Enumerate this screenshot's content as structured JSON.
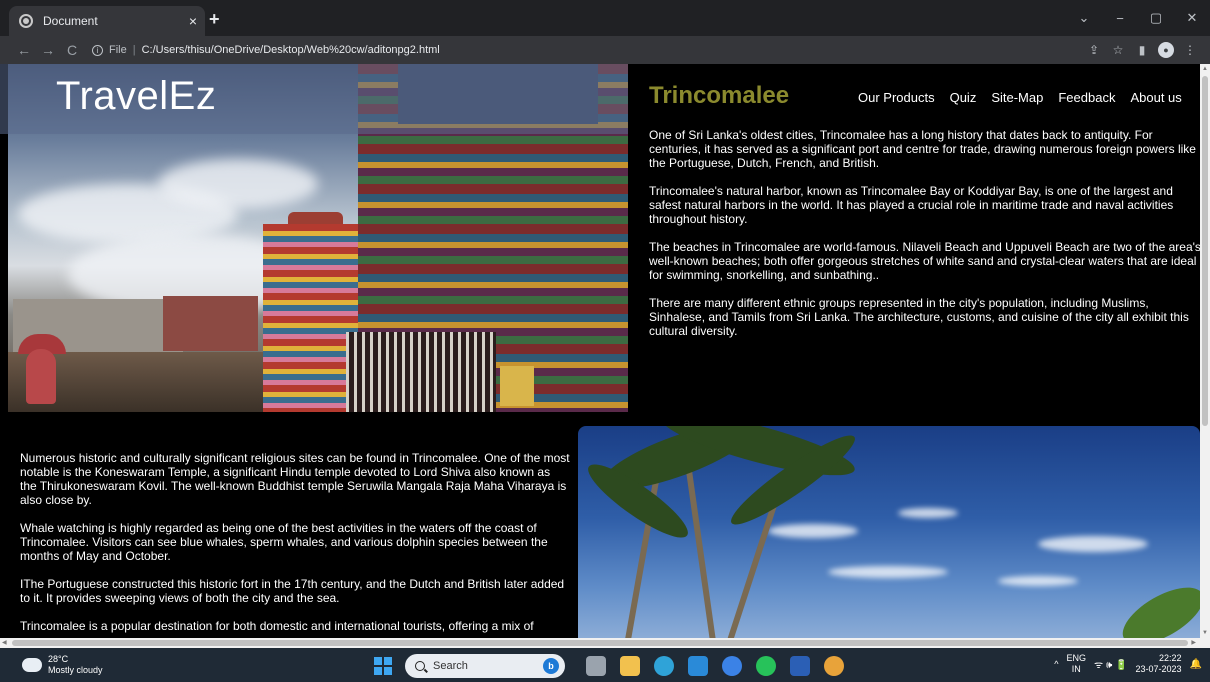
{
  "browser": {
    "tab_title": "Document",
    "tab_close": "×",
    "new_tab": "+",
    "window_controls": [
      "⌄",
      "−",
      "▢",
      "✕"
    ],
    "nav": {
      "back": "←",
      "forward": "→",
      "reload": "C"
    },
    "url_scheme": "File",
    "url_separator": "|",
    "url": "C:/Users/thisu/OneDrive/Desktop/Web%20cw/aditonpg2.html",
    "tool_icons": [
      "share-icon",
      "star-icon",
      "sidepanel-icon",
      "profile-icon",
      "menu-icon"
    ]
  },
  "page": {
    "logo": "TravelEz",
    "city_title": "Trincomalee",
    "nav_links": [
      "Our Products",
      "Quiz",
      "Site-Map",
      "Feedback",
      "About us"
    ],
    "right_paragraphs": [
      "One of Sri Lanka's oldest cities, Trincomalee has a long history that dates back to antiquity. For centuries, it has served as a significant port and centre for trade, drawing numerous foreign powers like the Portuguese, Dutch, French, and British.",
      "Trincomalee's natural harbor, known as Trincomalee Bay or Koddiyar Bay, is one of the largest and safest natural harbors in the world. It has played a crucial role in maritime trade and naval activities throughout history.",
      "The beaches in Trincomalee are world-famous. Nilaveli Beach and Uppuveli Beach are two of the area's well-known beaches; both offer gorgeous stretches of white sand and crystal-clear waters that are ideal for swimming, snorkelling, and sunbathing..",
      "There are many different ethnic groups represented in the city's population, including Muslims, Sinhalese, and Tamils from Sri Lanka. The architecture, customs, and cuisine of the city all exhibit this cultural diversity."
    ],
    "left_paragraphs": [
      "Numerous historic and culturally significant religious sites can be found in Trincomalee. One of the most notable is the Koneswaram Temple, a significant Hindu temple devoted to Lord Shiva also known as the Thirukoneswaram Kovil. The well-known Buddhist temple Seruwila Mangala Raja Maha Viharaya is also close by.",
      "Whale watching is highly regarded as being one of the best activities in the waters off the coast of Trincomalee. Visitors can see blue whales, sperm whales, and various dolphin species between the months of May and October.",
      "IThe Portuguese constructed this historic fort in the 17th century, and the Dutch and British later added to it. It provides sweeping views of both the city and the sea.",
      "Trincomalee is a popular destination for both domestic and international tourists, offering a mix of"
    ]
  },
  "taskbar": {
    "temperature": "28°C",
    "weather": "Mostly cloudy",
    "search_placeholder": "Search",
    "bing": "b",
    "apps": [
      {
        "name": "file-explorer-icon",
        "color": "#f2c14e"
      },
      {
        "name": "edge-icon",
        "color": "#2fa3d8"
      },
      {
        "name": "vscode-icon",
        "color": "#2a8ad8"
      },
      {
        "name": "chrome-icon-2",
        "color": "#3b82e6"
      },
      {
        "name": "whatsapp-icon",
        "color": "#27c25a"
      },
      {
        "name": "word-icon",
        "color": "#2b5fb5"
      },
      {
        "name": "chrome-icon",
        "color": "#e8a33a"
      }
    ],
    "tray_chevron": "^",
    "lang_primary": "ENG",
    "lang_secondary": "IN",
    "tray_icons": "ᯤ 🕪 🔋",
    "time": "22:22",
    "date": "23-07-2023",
    "notification": "🔔"
  }
}
